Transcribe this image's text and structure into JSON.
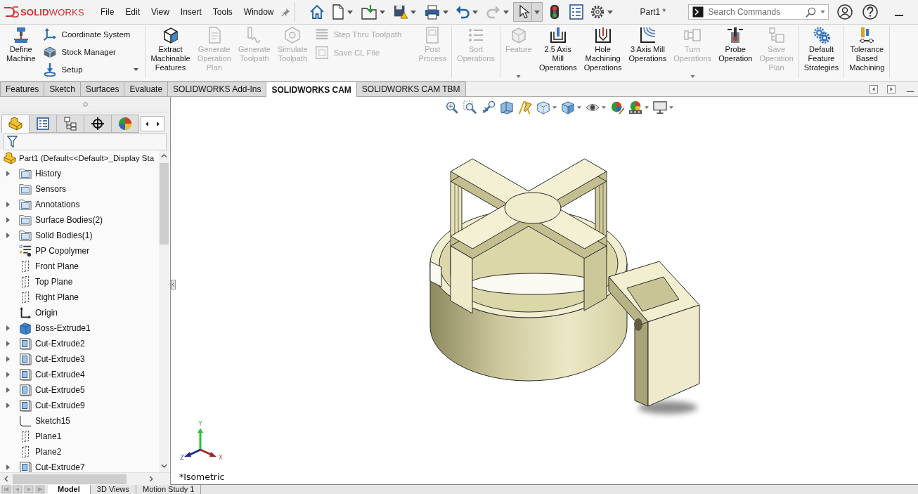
{
  "app": {
    "logo": "**SOLID**WORKS"
  },
  "menu": [
    "File",
    "Edit",
    "View",
    "Insert",
    "Tools",
    "Window"
  ],
  "quick_access": {
    "redo": {
      "disabled": true
    },
    "select": {
      "selected": true
    }
  },
  "document_title": "Part1 *",
  "search": {
    "placeholder": "Search Commands"
  },
  "ribbon": {
    "groups": [
      {
        "items": [
          {
            "kind": "large",
            "label": "Define\nMachine",
            "disabled": false,
            "dropdown": false
          },
          {
            "kind": "stack",
            "items": [
              {
                "label": "Coordinate System",
                "disabled": false,
                "dropdown": false
              },
              {
                "label": "Stock Manager",
                "disabled": false,
                "dropdown": false
              },
              {
                "label": "Setup",
                "disabled": false,
                "dropdown": true
              }
            ]
          }
        ]
      },
      {
        "items": [
          {
            "kind": "large",
            "label": "Extract\nMachinable\nFeatures",
            "disabled": false,
            "dropdown": false
          },
          {
            "kind": "large",
            "label": "Generate\nOperation\nPlan",
            "disabled": true,
            "dropdown": false
          },
          {
            "kind": "large",
            "label": "Generate\nToolpath",
            "disabled": true,
            "dropdown": false
          },
          {
            "kind": "large",
            "label": "Simulate\nToolpath",
            "disabled": true,
            "dropdown": false
          },
          {
            "kind": "stack",
            "items": [
              {
                "label": "Step Thru Toolpath",
                "disabled": true,
                "dropdown": false
              },
              {
                "label": "Save CL File",
                "disabled": true,
                "dropdown": false
              }
            ]
          },
          {
            "kind": "large",
            "label": "Post\nProcess",
            "disabled": true,
            "dropdown": false
          }
        ]
      },
      {
        "items": [
          {
            "kind": "large",
            "label": "Sort\nOperations",
            "disabled": true,
            "dropdown": false
          }
        ]
      },
      {
        "items": [
          {
            "kind": "large",
            "label": "Feature",
            "disabled": true,
            "dropdown": true
          },
          {
            "kind": "large",
            "label": "2.5 Axis\nMill\nOperations",
            "disabled": false,
            "dropdown": false
          },
          {
            "kind": "large",
            "label": "Hole\nMachining\nOperations",
            "disabled": false,
            "dropdown": false
          },
          {
            "kind": "large",
            "label": "3 Axis Mill\nOperations",
            "disabled": false,
            "dropdown": false
          },
          {
            "kind": "large",
            "label": "Turn\nOperations",
            "disabled": true,
            "dropdown": true
          },
          {
            "kind": "large",
            "label": "Probe\nOperation",
            "disabled": false,
            "dropdown": false
          },
          {
            "kind": "large",
            "label": "Save\nOperation\nPlan",
            "disabled": true,
            "dropdown": false
          }
        ]
      },
      {
        "items": [
          {
            "kind": "large",
            "label": "Default\nFeature\nStrategies",
            "disabled": false,
            "dropdown": false
          }
        ]
      },
      {
        "items": [
          {
            "kind": "large",
            "label": "Tolerance\nBased\nMachining",
            "disabled": false,
            "dropdown": false
          }
        ]
      }
    ]
  },
  "command_tabs": [
    {
      "label": "Features",
      "selected": false
    },
    {
      "label": "Sketch",
      "selected": false
    },
    {
      "label": "Surfaces",
      "selected": false
    },
    {
      "label": "Evaluate",
      "selected": false
    },
    {
      "label": "SOLIDWORKS Add-Ins",
      "selected": false
    },
    {
      "label": "SOLIDWORKS CAM",
      "selected": true
    },
    {
      "label": "SOLIDWORKS CAM TBM",
      "selected": false
    }
  ],
  "feature_manager": {
    "tabs": [
      {
        "kind": "feature-manager",
        "selected": true
      },
      {
        "kind": "property-manager",
        "selected": false
      },
      {
        "kind": "configuration-manager",
        "selected": false
      },
      {
        "kind": "dimxpert",
        "selected": false
      },
      {
        "kind": "display-manager",
        "selected": false
      }
    ],
    "tree": {
      "label": "Part1 (Default<<Default>_Display Sta",
      "kind": "part",
      "children": [
        {
          "label": "History",
          "kind": "folder",
          "expandable": true
        },
        {
          "label": "Sensors",
          "kind": "folder",
          "expandable": false
        },
        {
          "label": "Annotations",
          "kind": "folder",
          "expandable": true
        },
        {
          "label": "Surface Bodies(2)",
          "kind": "folder",
          "expandable": true
        },
        {
          "label": "Solid Bodies(1)",
          "kind": "folder",
          "expandable": true
        },
        {
          "label": "PP Copolymer",
          "kind": "material",
          "expandable": false
        },
        {
          "label": "Front Plane",
          "kind": "plane",
          "expandable": false
        },
        {
          "label": "Top Plane",
          "kind": "plane",
          "expandable": false
        },
        {
          "label": "Right Plane",
          "kind": "plane",
          "expandable": false
        },
        {
          "label": "Origin",
          "kind": "origin",
          "expandable": false
        },
        {
          "label": "Boss-Extrude1",
          "kind": "boss-extrude",
          "expandable": true
        },
        {
          "label": "Cut-Extrude2",
          "kind": "cut-extrude",
          "expandable": true
        },
        {
          "label": "Cut-Extrude3",
          "kind": "cut-extrude",
          "expandable": true
        },
        {
          "label": "Cut-Extrude4",
          "kind": "cut-extrude",
          "expandable": true
        },
        {
          "label": "Cut-Extrude5",
          "kind": "cut-extrude",
          "expandable": true
        },
        {
          "label": "Cut-Extrude9",
          "kind": "cut-extrude",
          "expandable": true
        },
        {
          "label": "Sketch15",
          "kind": "sketch",
          "expandable": false
        },
        {
          "label": "Plane1",
          "kind": "plane",
          "expandable": false
        },
        {
          "label": "Plane2",
          "kind": "plane",
          "expandable": false
        },
        {
          "label": "Cut-Extrude7",
          "kind": "cut-extrude",
          "expandable": true
        }
      ]
    }
  },
  "viewport": {
    "view_name": "*Isometric",
    "triad": {
      "x": "X",
      "y": "Y",
      "z": "Z"
    }
  },
  "document_tabs": [
    {
      "label": "Model",
      "selected": true
    },
    {
      "label": "3D Views",
      "selected": false
    },
    {
      "label": "Motion Study 1",
      "selected": false
    }
  ]
}
